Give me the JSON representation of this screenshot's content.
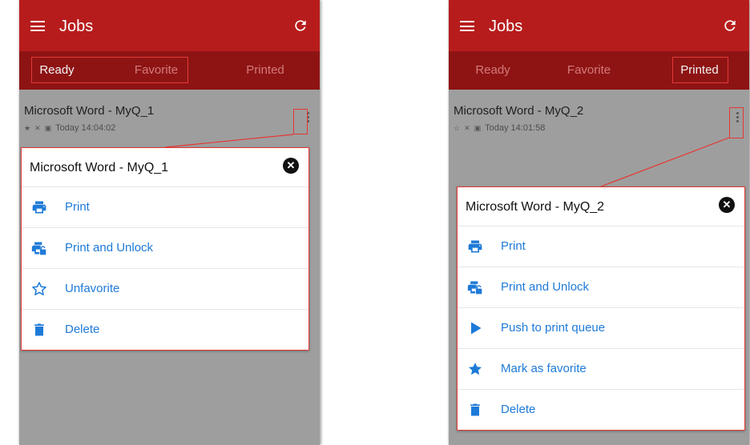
{
  "left": {
    "appbar": {
      "title": "Jobs"
    },
    "tabs": [
      "Ready",
      "Favorite",
      "Printed"
    ],
    "job": {
      "name": "Microsoft Word - MyQ_1",
      "time": "Today 14:04:02"
    },
    "dialog": {
      "title": "Microsoft Word - MyQ_1",
      "items": [
        {
          "label": "Print",
          "icon": "print-icon"
        },
        {
          "label": "Print and Unlock",
          "icon": "print-unlock-icon"
        },
        {
          "label": "Unfavorite",
          "icon": "star-outline-icon"
        },
        {
          "label": "Delete",
          "icon": "trash-icon"
        }
      ]
    }
  },
  "right": {
    "appbar": {
      "title": "Jobs"
    },
    "tabs": [
      "Ready",
      "Favorite",
      "Printed"
    ],
    "job": {
      "name": "Microsoft Word - MyQ_2",
      "time": "Today 14:01:58"
    },
    "dialog": {
      "title": "Microsoft Word - MyQ_2",
      "items": [
        {
          "label": "Print",
          "icon": "print-icon"
        },
        {
          "label": "Print and Unlock",
          "icon": "print-unlock-icon"
        },
        {
          "label": "Push to print queue",
          "icon": "play-icon"
        },
        {
          "label": "Mark as favorite",
          "icon": "star-filled-icon"
        },
        {
          "label": "Delete",
          "icon": "trash-icon"
        }
      ]
    }
  },
  "colors": {
    "appbar": "#b71c1c",
    "tabs": "#8e1414",
    "link": "#1e7ad8",
    "highlight": "#e53935",
    "dim": "#9e9e9e"
  }
}
